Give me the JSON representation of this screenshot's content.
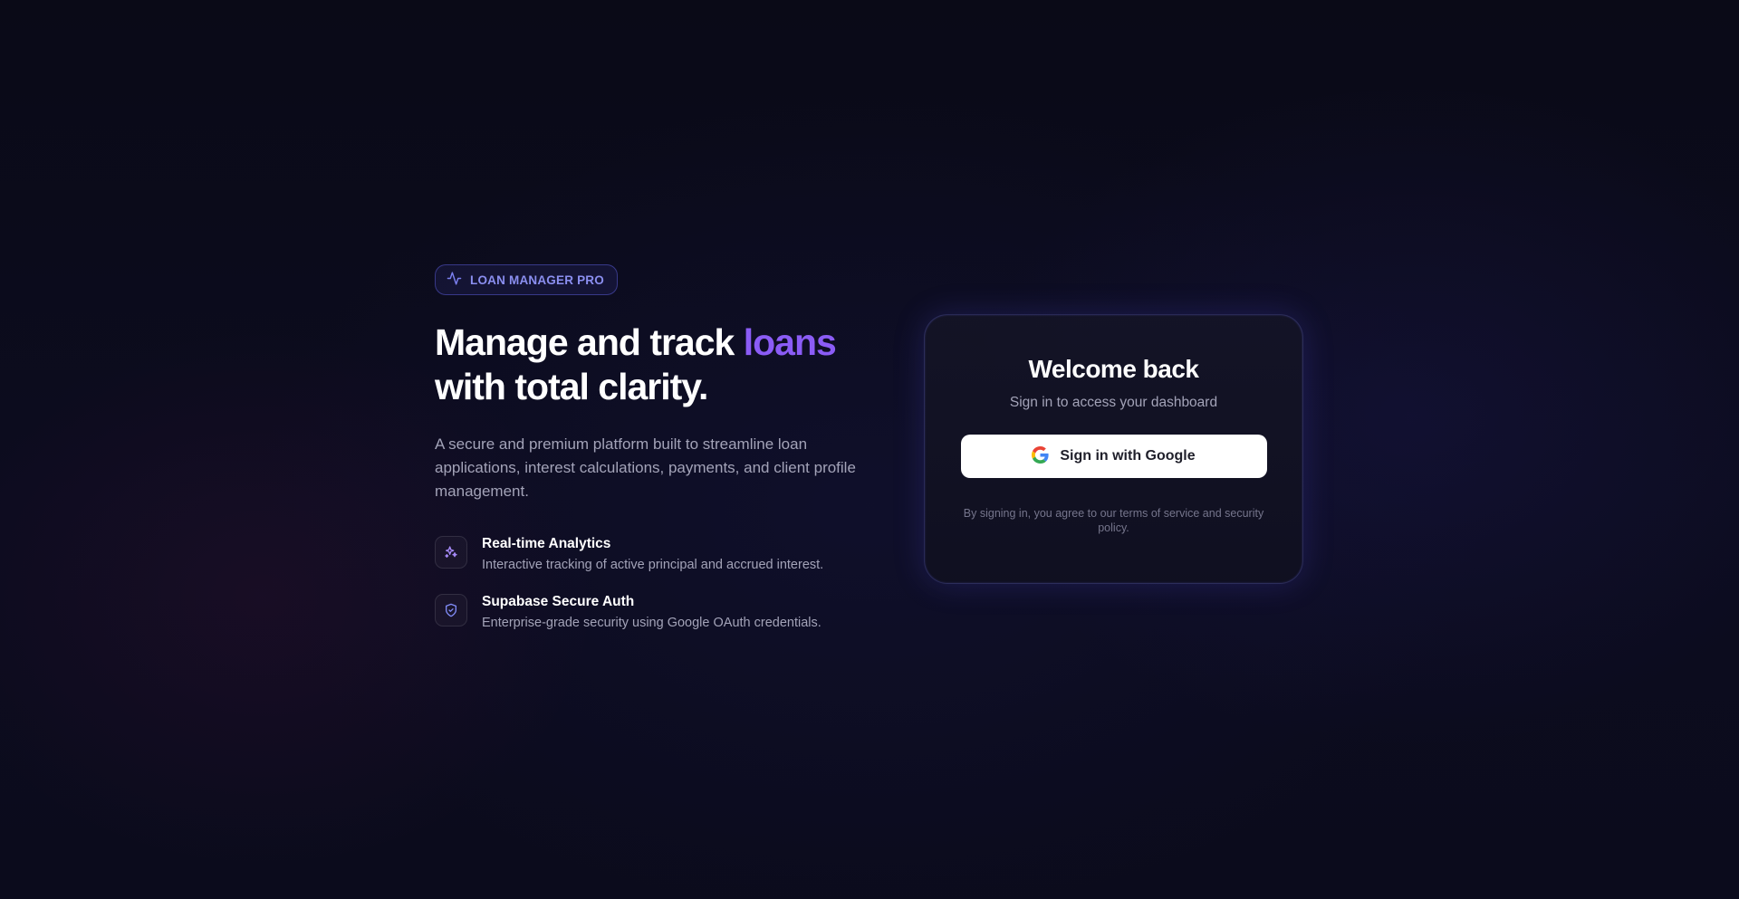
{
  "brand": {
    "badge_label": "LOAN MANAGER PRO",
    "badge_icon": "activity-icon",
    "accent_color": "#8b5cf6"
  },
  "hero": {
    "headline_part1": "Manage and track ",
    "headline_accent": "loans",
    "headline_part2": "with total clarity.",
    "description": "A secure and premium platform built to streamline loan applications, interest calculations, payments, and client profile management."
  },
  "features": [
    {
      "icon": "sparkles-icon",
      "title": "Real-time Analytics",
      "description": "Interactive tracking of active principal and accrued interest."
    },
    {
      "icon": "shield-check-icon",
      "title": "Supabase Secure Auth",
      "description": "Enterprise-grade security using Google OAuth credentials."
    }
  ],
  "login": {
    "title": "Welcome back",
    "subtitle": "Sign in to access your dashboard",
    "google_button_label": "Sign in with Google",
    "terms": "By signing in, you agree to our terms of service and security policy."
  }
}
